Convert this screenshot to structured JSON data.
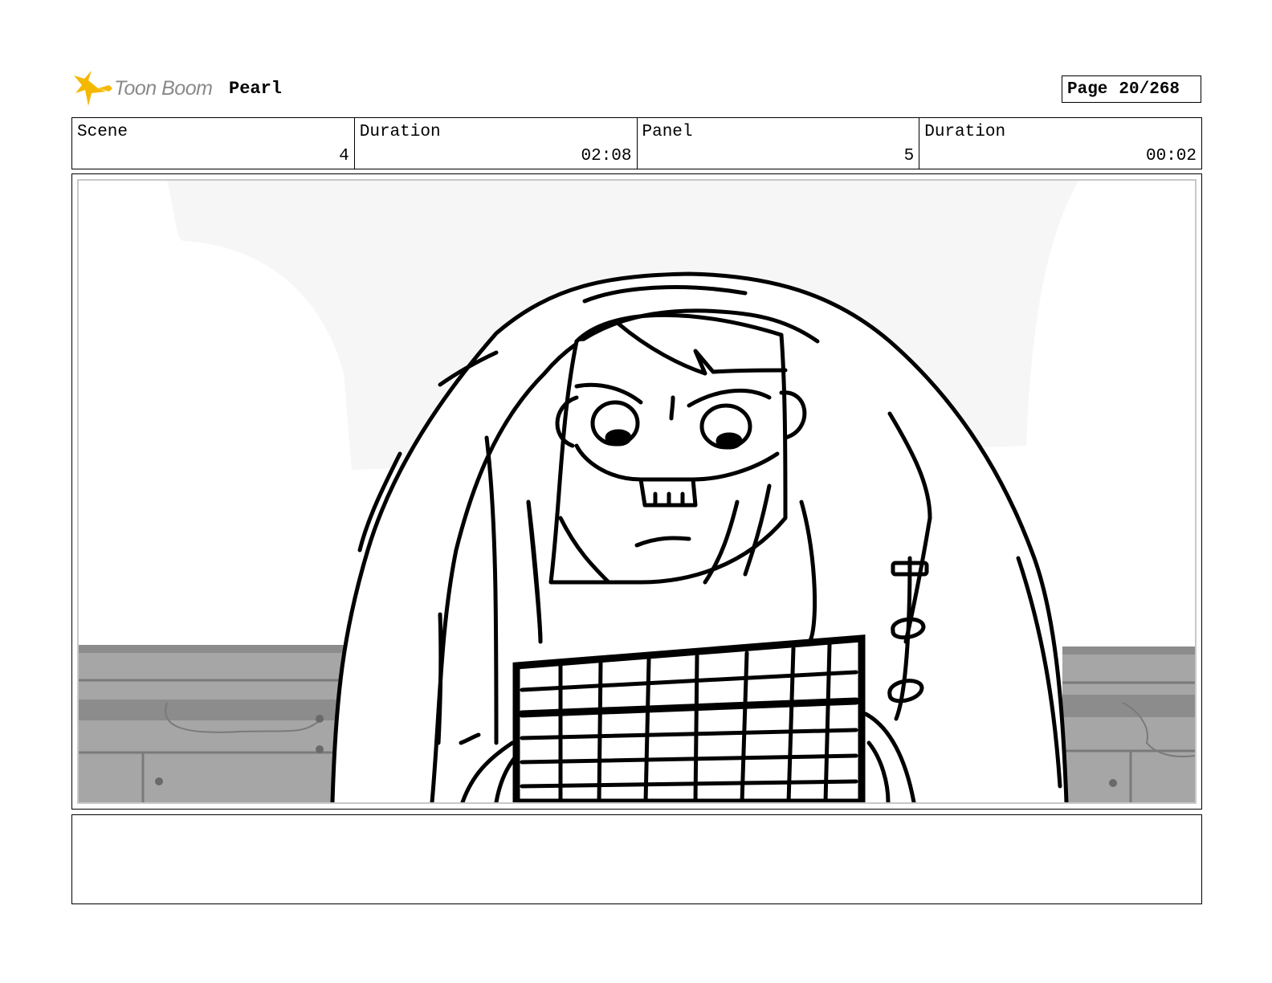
{
  "header": {
    "logo_text": "Toon Boom",
    "logo_icon": "comet-star-icon",
    "project_title": "Pearl",
    "page_label": "Page",
    "page_value": "20/268"
  },
  "info": {
    "scene_label": "Scene",
    "scene_value": "4",
    "scene_duration_label": "Duration",
    "scene_duration_value": "02:08",
    "panel_label": "Panel",
    "panel_value": "5",
    "panel_duration_label": "Duration",
    "panel_duration_value": "00:02"
  },
  "notes": {
    "text": ""
  },
  "colors": {
    "logo_yellow": "#f5b800",
    "logo_gray": "#8a8a8a",
    "sky": "#f6f6f6",
    "wall_dark": "#8c8c8c",
    "wall_light": "#a8a8a8"
  }
}
